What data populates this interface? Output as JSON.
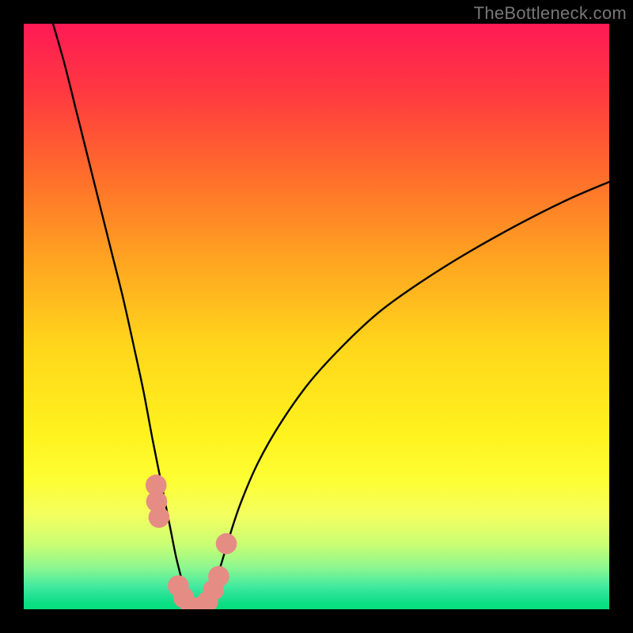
{
  "watermark": "TheBottleneck.com",
  "chart_data": {
    "type": "line",
    "title": "",
    "xlabel": "",
    "ylabel": "",
    "xlim": [
      0,
      100
    ],
    "ylim": [
      0,
      100
    ],
    "background_gradient": {
      "orientation": "vertical",
      "stops": [
        {
          "pct": 0,
          "color": "#ff1a55"
        },
        {
          "pct": 12,
          "color": "#ff3a40"
        },
        {
          "pct": 25,
          "color": "#ff6a2c"
        },
        {
          "pct": 40,
          "color": "#ffa321"
        },
        {
          "pct": 55,
          "color": "#ffd61b"
        },
        {
          "pct": 70,
          "color": "#fff21e"
        },
        {
          "pct": 78,
          "color": "#fdfe34"
        },
        {
          "pct": 84,
          "color": "#f3ff60"
        },
        {
          "pct": 89,
          "color": "#c9fe74"
        },
        {
          "pct": 93,
          "color": "#8af690"
        },
        {
          "pct": 96,
          "color": "#44eaa0"
        },
        {
          "pct": 98,
          "color": "#1de18f"
        },
        {
          "pct": 100,
          "color": "#07dd7e"
        }
      ]
    },
    "series": [
      {
        "name": "left-branch",
        "color": "#000000",
        "x": [
          5,
          7,
          9,
          11,
          13,
          15,
          17,
          19,
          20.5,
          22,
          23.5,
          25,
          26,
          27,
          27.8,
          28.5
        ],
        "y": [
          100,
          93,
          85,
          77,
          69,
          61,
          53,
          44,
          37,
          29,
          21.5,
          14,
          9,
          5,
          2,
          0
        ]
      },
      {
        "name": "right-branch",
        "color": "#000000",
        "x": [
          31,
          32,
          33.5,
          35,
          37,
          40,
          44,
          49,
          55,
          61,
          68,
          76,
          85,
          93,
          100
        ],
        "y": [
          0,
          3,
          7,
          12,
          18,
          25,
          32,
          39,
          45.5,
          51,
          56,
          61,
          66,
          70,
          73
        ]
      },
      {
        "name": "valley-floor",
        "color": "#000000",
        "x": [
          28.5,
          29.2,
          30,
          30.5,
          31
        ],
        "y": [
          0,
          0,
          0,
          0,
          0
        ]
      }
    ],
    "markers": [
      {
        "name": "left-cluster-upper-1",
        "x": 22.6,
        "y": 21.2,
        "r": 1.8,
        "color": "#e58d85"
      },
      {
        "name": "left-cluster-upper-2",
        "x": 22.7,
        "y": 18.4,
        "r": 1.8,
        "color": "#e58d85"
      },
      {
        "name": "left-cluster-upper-3",
        "x": 23.1,
        "y": 15.7,
        "r": 1.8,
        "color": "#e58d85"
      },
      {
        "name": "valley-left-1",
        "x": 26.4,
        "y": 4.0,
        "r": 1.8,
        "color": "#e58d85"
      },
      {
        "name": "valley-left-2",
        "x": 27.3,
        "y": 2.0,
        "r": 1.8,
        "color": "#e58d85"
      },
      {
        "name": "valley-bottom-1",
        "x": 28.6,
        "y": 0.4,
        "r": 1.8,
        "color": "#e58d85"
      },
      {
        "name": "valley-bottom-2",
        "x": 30.0,
        "y": 0.3,
        "r": 1.8,
        "color": "#e58d85"
      },
      {
        "name": "valley-right-1",
        "x": 31.4,
        "y": 1.3,
        "r": 1.8,
        "color": "#e58d85"
      },
      {
        "name": "valley-right-2",
        "x": 32.4,
        "y": 3.3,
        "r": 1.8,
        "color": "#e58d85"
      },
      {
        "name": "valley-right-3",
        "x": 33.3,
        "y": 5.6,
        "r": 1.8,
        "color": "#e58d85"
      },
      {
        "name": "right-isolated",
        "x": 34.6,
        "y": 11.2,
        "r": 1.8,
        "color": "#e58d85"
      }
    ]
  }
}
